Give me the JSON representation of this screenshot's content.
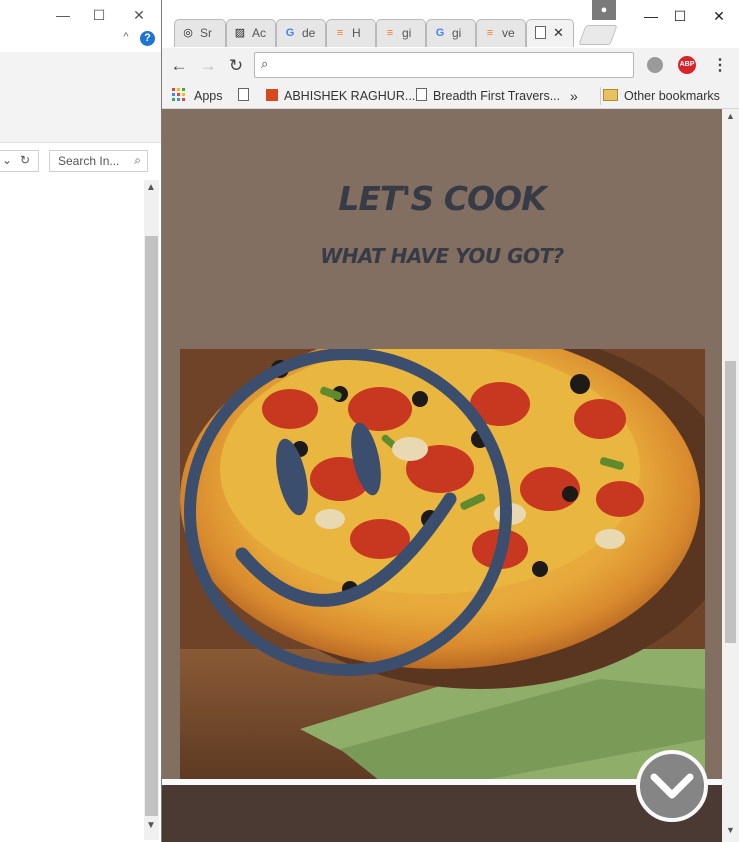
{
  "explorer": {
    "window_controls": {
      "minimize": "—",
      "maximize": "☐",
      "close": "✕"
    },
    "ribbon_caret": "^",
    "help": "?",
    "search_placeholder": "Search In...",
    "search_icon": "⌕",
    "nav_chevron": "⌄",
    "refresh": "↻"
  },
  "browser": {
    "tabs": [
      {
        "icon": "github-icon",
        "glyph": "◎",
        "label": "Sr"
      },
      {
        "icon": "image-icon",
        "glyph": "▨",
        "label": "Ac"
      },
      {
        "icon": "google-icon",
        "glyph": "G",
        "label": "de"
      },
      {
        "icon": "stackoverflow-icon",
        "glyph": "≡",
        "label": "H"
      },
      {
        "icon": "stackoverflow-icon",
        "glyph": "≡",
        "label": "gi"
      },
      {
        "icon": "google-icon",
        "glyph": "G",
        "label": "gi"
      },
      {
        "icon": "stackoverflow-icon",
        "glyph": "≡",
        "label": "ve"
      }
    ],
    "active_tab": {
      "icon": "page-icon",
      "close": "✕"
    },
    "profile_icon": "👤",
    "window_controls": {
      "minimize": "—",
      "maximize": "☐",
      "close": "✕"
    },
    "nav": {
      "back": "←",
      "forward": "→",
      "reload": "↻",
      "menu": "⋮"
    },
    "omnibox_value": "",
    "extension_abp": "ABP",
    "bookmarks": {
      "apps": "Apps",
      "item1": "ABHISHEK RAGHUR...",
      "item2": "Breadth First Travers...",
      "overflow": "»",
      "other": "Other bookmarks"
    }
  },
  "page": {
    "title": "LET'S COOK",
    "subtitle": "WHAT HAVE YOU GOT?",
    "scroll_down_icon": "chevron-down-icon",
    "colors": {
      "background": "#836f61",
      "heading": "#373b46",
      "smiley": "#3b4e6e",
      "footer": "#4a3a33"
    }
  }
}
